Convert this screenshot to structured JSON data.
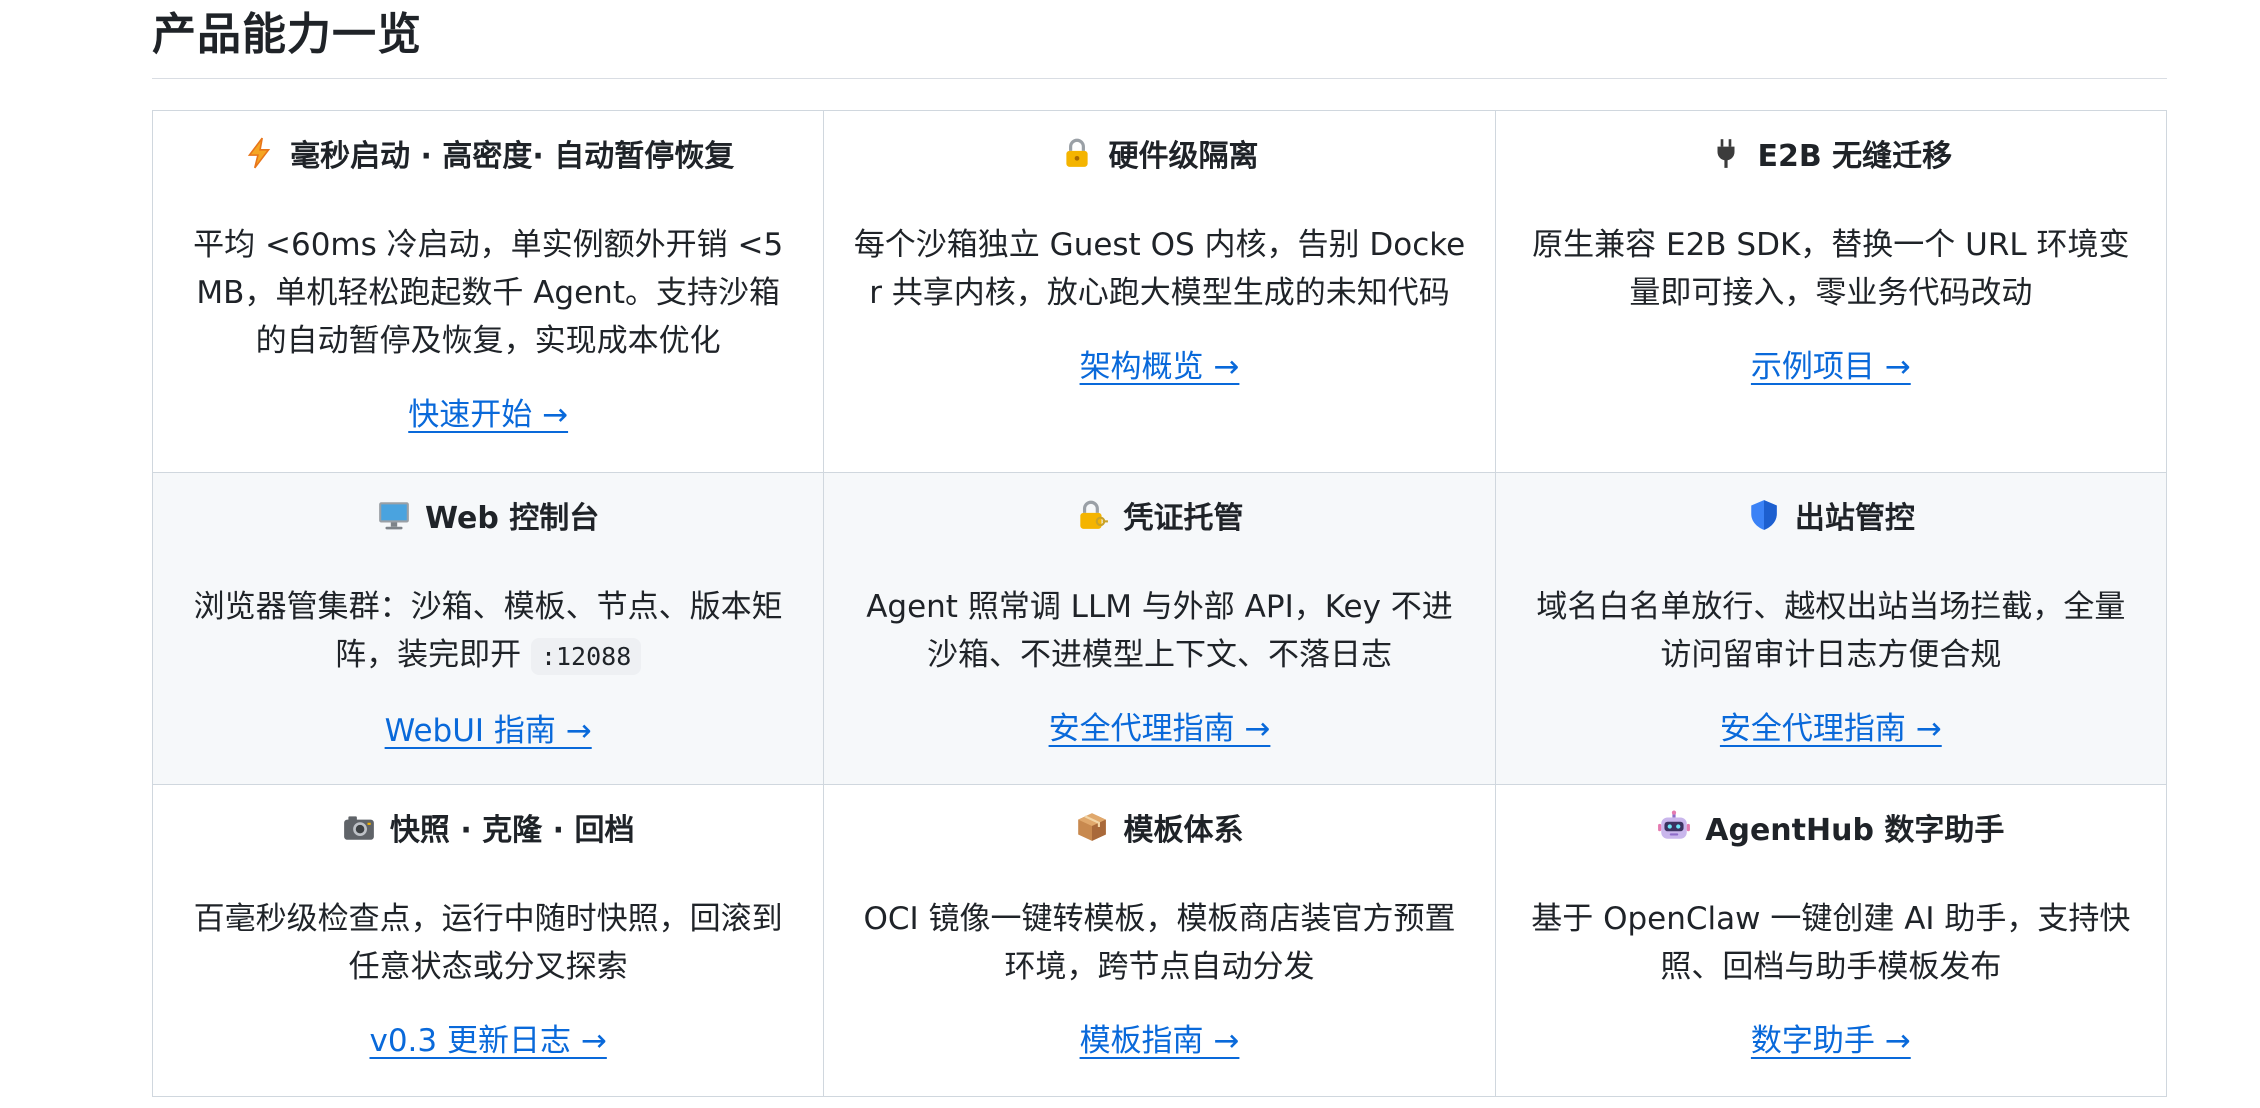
{
  "section": {
    "title": "产品能力一览"
  },
  "cards": [
    {
      "icon": "lightning-icon",
      "title": "毫秒启动 · 高密度· 自动暂停恢复",
      "desc": "平均 <60ms 冷启动，单实例额外开销 <5MB，单机轻松跑起数千 Agent。支持沙箱的自动暂停及恢复，实现成本优化",
      "link": "快速开始 →"
    },
    {
      "icon": "lock-icon",
      "title": "硬件级隔离",
      "desc": "每个沙箱独立 Guest OS 内核，告别 Docker 共享内核，放心跑大模型生成的未知代码",
      "link": "架构概览 →"
    },
    {
      "icon": "plug-icon",
      "title": "E2B 无缝迁移",
      "desc": "原生兼容 E2B SDK，替换一个 URL 环境变量即可接入，零业务代码改动",
      "link": "示例项目 →"
    },
    {
      "icon": "monitor-icon",
      "title": "Web 控制台",
      "desc": "浏览器管集群：沙箱、模板、节点、版本矩阵，装完即开",
      "code": ":12088",
      "link": "WebUI 指南 →"
    },
    {
      "icon": "lock-key-icon",
      "title": "凭证托管",
      "desc": "Agent 照常调 LLM 与外部 API，Key 不进沙箱、不进模型上下文、不落日志",
      "link": "安全代理指南 →"
    },
    {
      "icon": "shield-icon",
      "title": "出站管控",
      "desc": "域名白名单放行、越权出站当场拦截，全量访问留审计日志方便合规",
      "link": "安全代理指南 →"
    },
    {
      "icon": "camera-icon",
      "title": "快照 · 克隆 · 回档",
      "desc": "百毫秒级检查点，运行中随时快照，回滚到任意状态或分叉探索",
      "link": "v0.3 更新日志 →"
    },
    {
      "icon": "package-icon",
      "title": "模板体系",
      "desc": "OCI 镜像一键转模板，模板商店装官方预置环境，跨节点自动分发",
      "link": "模板指南 →"
    },
    {
      "icon": "robot-icon",
      "title": "AgentHub 数字助手",
      "desc": "基于 OpenClaw 一键创建 AI 助手，支持快照、回档与助手模板发布",
      "link": "数字助手 →"
    }
  ],
  "colors": {
    "link": "#0969da",
    "border": "#d0d7de",
    "alt_row_bg": "#f6f8fa"
  }
}
